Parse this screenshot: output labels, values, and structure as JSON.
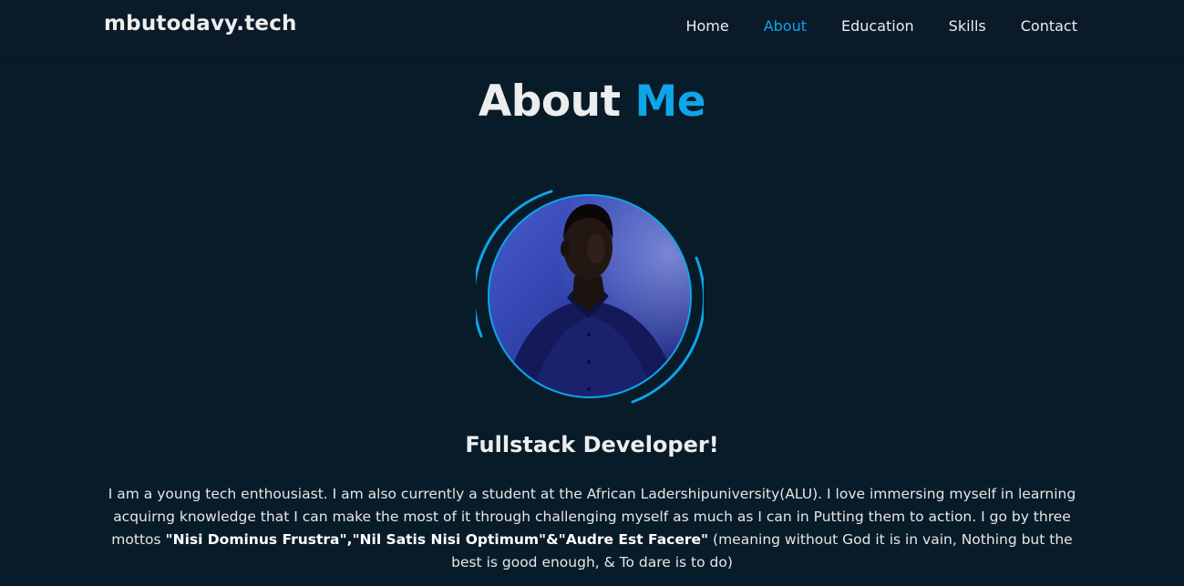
{
  "header": {
    "logo": "mbutodavy.tech",
    "nav": [
      "Home",
      "About",
      "Education",
      "Skills",
      "Contact"
    ],
    "active_nav": "About"
  },
  "about": {
    "title_main": "About",
    "title_accent": "Me",
    "role": "Fullstack Developer!",
    "bio_intro": "I am a young tech enthousiast. I am also currently a student at the African Ladershipuniversity(ALU). I love immersing myself in learning acquirng knowledge that I can make the most of it through challenging myself as much as I can in Putting them to action. I go by three mottos ",
    "mottos": "\"Nisi Dominus Frustra\",\"Nil Satis Nisi Optimum\"&\"Audre Est Facere\"",
    "bio_outro": " (meaning without God it is in vain, Nothing but the best is good enough, & To dare is to do)"
  },
  "colors": {
    "background": "#081b29",
    "header": "#0a1a28",
    "accent": "#0ea5e9",
    "text": "#ededed"
  }
}
